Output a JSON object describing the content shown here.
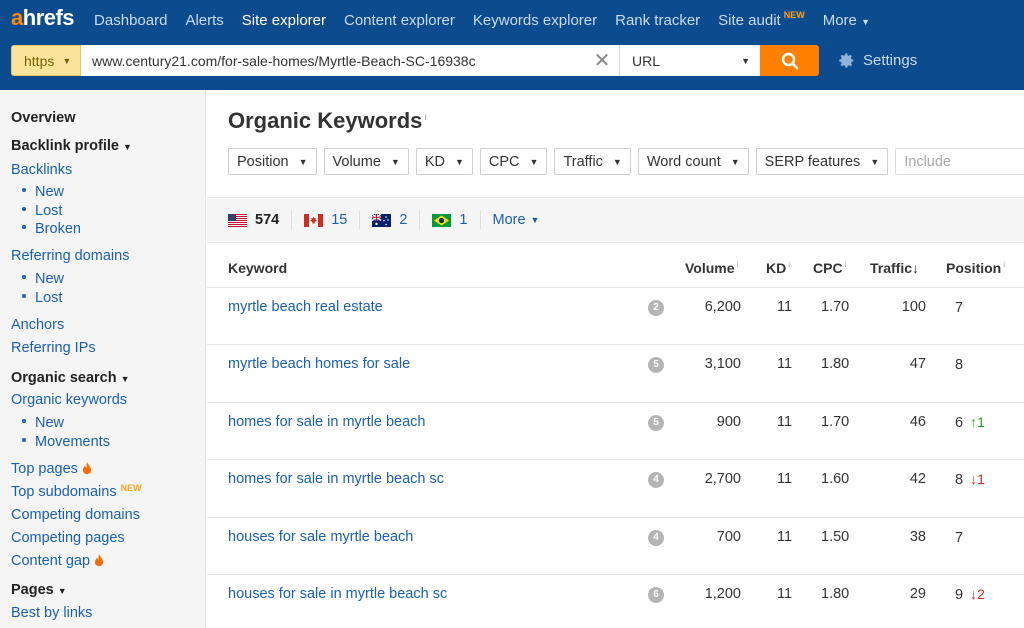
{
  "nav": {
    "logo_a": "a",
    "logo_rest": "hrefs",
    "items": [
      {
        "label": "Dashboard"
      },
      {
        "label": "Alerts"
      },
      {
        "label": "Site explorer"
      },
      {
        "label": "Content explorer"
      },
      {
        "label": "Keywords explorer"
      },
      {
        "label": "Rank tracker"
      },
      {
        "label": "Site audit",
        "badge": "NEW"
      },
      {
        "label": "More"
      }
    ],
    "active_item": "Site explorer"
  },
  "search": {
    "protocol": "https",
    "url": "www.century21.com/for-sale-homes/Myrtle-Beach-SC-16938c",
    "mode": "URL",
    "settings_label": "Settings"
  },
  "sidebar": {
    "overview": "Overview",
    "backlink_profile": "Backlink profile",
    "backlinks": "Backlinks",
    "backlinks_new": "New",
    "backlinks_lost": "Lost",
    "backlinks_broken": "Broken",
    "referring_domains": "Referring domains",
    "rd_new": "New",
    "rd_lost": "Lost",
    "anchors": "Anchors",
    "referring_ips": "Referring IPs",
    "organic_search": "Organic search",
    "organic_keywords": "Organic keywords",
    "ok_new": "New",
    "ok_movements": "Movements",
    "top_pages": "Top pages",
    "top_subdomains": "Top subdomains",
    "top_subdomains_badge": "NEW",
    "competing_domains": "Competing domains",
    "competing_pages": "Competing pages",
    "content_gap": "Content gap",
    "pages": "Pages",
    "best_by_links": "Best by links"
  },
  "main": {
    "title": "Organic Keywords",
    "title_info": "i",
    "filters": [
      "Position",
      "Volume",
      "KD",
      "CPC",
      "Traffic",
      "Word count",
      "SERP features"
    ],
    "include_placeholder": "Include",
    "countries": [
      {
        "flag": "us",
        "count": "574"
      },
      {
        "flag": "ca",
        "count": "15"
      },
      {
        "flag": "au",
        "count": "2"
      },
      {
        "flag": "br",
        "count": "1"
      }
    ],
    "countries_more": "More",
    "columns": {
      "keyword": "Keyword",
      "volume": "Volume",
      "kd": "KD",
      "cpc": "CPC",
      "traffic": "Traffic",
      "traffic_sort": "↓",
      "position": "Position",
      "info": "i"
    },
    "rows": [
      {
        "keyword": "myrtle beach real estate",
        "serp": "2",
        "volume": "6,200",
        "kd": "11",
        "cpc": "1.70",
        "traffic": "100",
        "position": "7",
        "change": "",
        "change_dir": ""
      },
      {
        "keyword": "myrtle beach homes for sale",
        "serp": "5",
        "volume": "3,100",
        "kd": "11",
        "cpc": "1.80",
        "traffic": "47",
        "position": "8",
        "change": "",
        "change_dir": ""
      },
      {
        "keyword": "homes for sale in myrtle beach",
        "serp": "5",
        "volume": "900",
        "kd": "11",
        "cpc": "1.70",
        "traffic": "46",
        "position": "6",
        "change": "↑1",
        "change_dir": "up"
      },
      {
        "keyword": "homes for sale in myrtle beach sc",
        "serp": "4",
        "volume": "2,700",
        "kd": "11",
        "cpc": "1.60",
        "traffic": "42",
        "position": "8",
        "change": "↓1",
        "change_dir": "down"
      },
      {
        "keyword": "houses for sale myrtle beach",
        "serp": "4",
        "volume": "700",
        "kd": "11",
        "cpc": "1.50",
        "traffic": "38",
        "position": "7",
        "change": "",
        "change_dir": ""
      },
      {
        "keyword": "houses for sale in myrtle beach sc",
        "serp": "6",
        "volume": "1,200",
        "kd": "11",
        "cpc": "1.80",
        "traffic": "29",
        "position": "9",
        "change": "↓2",
        "change_dir": "down"
      }
    ]
  },
  "colors": {
    "nav_bg": "#0c4b8e",
    "accent_orange": "#ff8000",
    "link_blue": "#1a5fb4",
    "up_green": "#2a9d2a",
    "down_red": "#c62828"
  }
}
